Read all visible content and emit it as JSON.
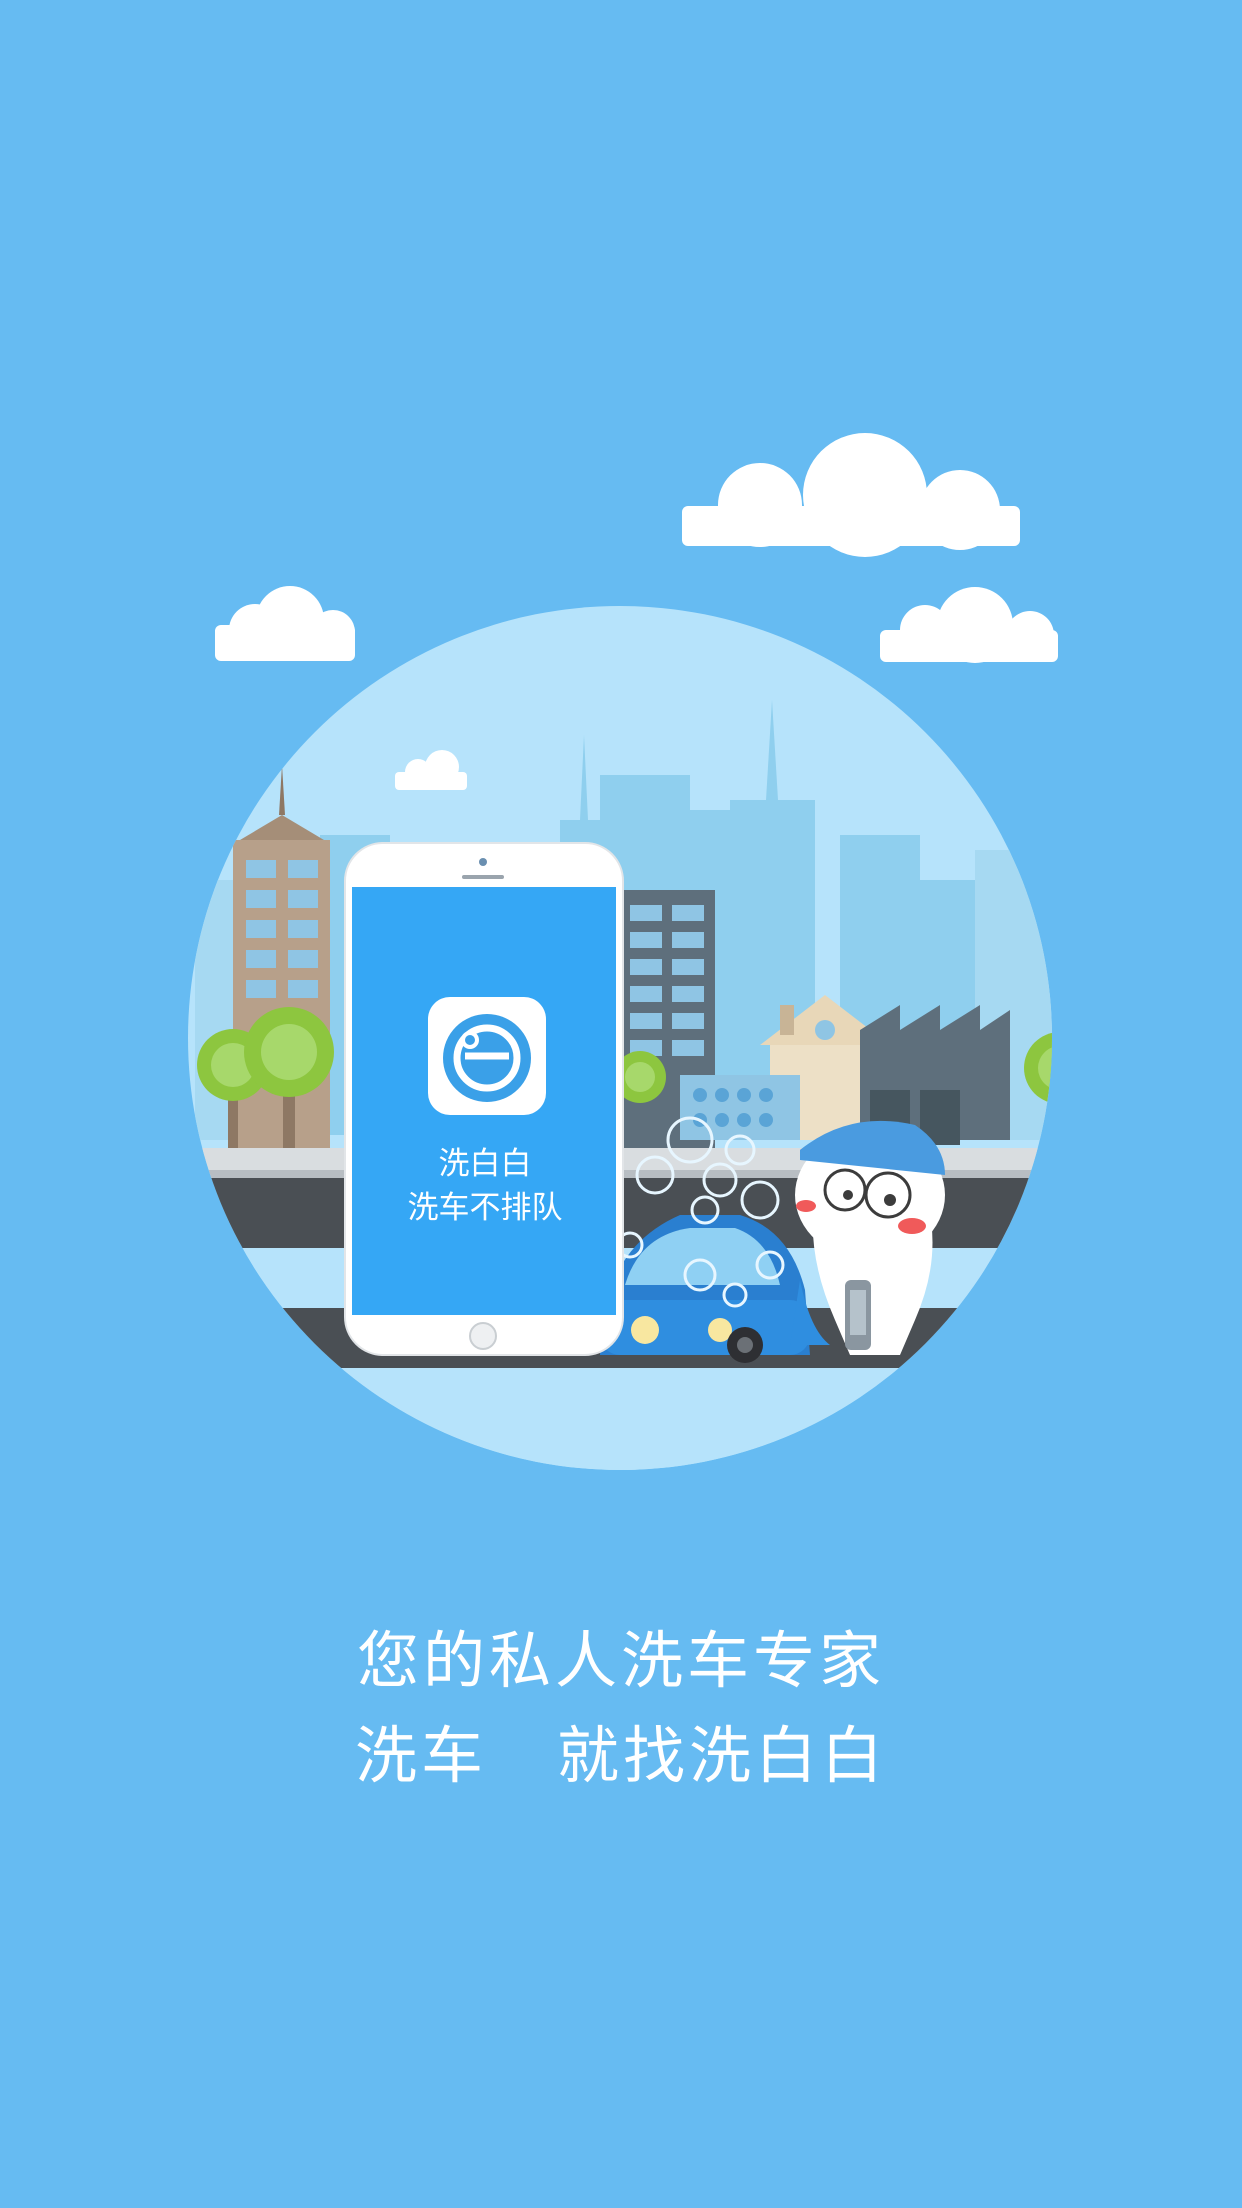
{
  "splash": {
    "phone_app_name": "洗白白",
    "phone_app_slogan": "洗车不排队",
    "tagline_line1": "您的私人洗车专家",
    "tagline_line2_part1": "洗车",
    "tagline_line2_part2": "就找洗白白"
  },
  "colors": {
    "background": "#66bbf2",
    "circle": "#b6e3fb",
    "phone_screen": "#35a7f5",
    "text": "#ffffff"
  }
}
